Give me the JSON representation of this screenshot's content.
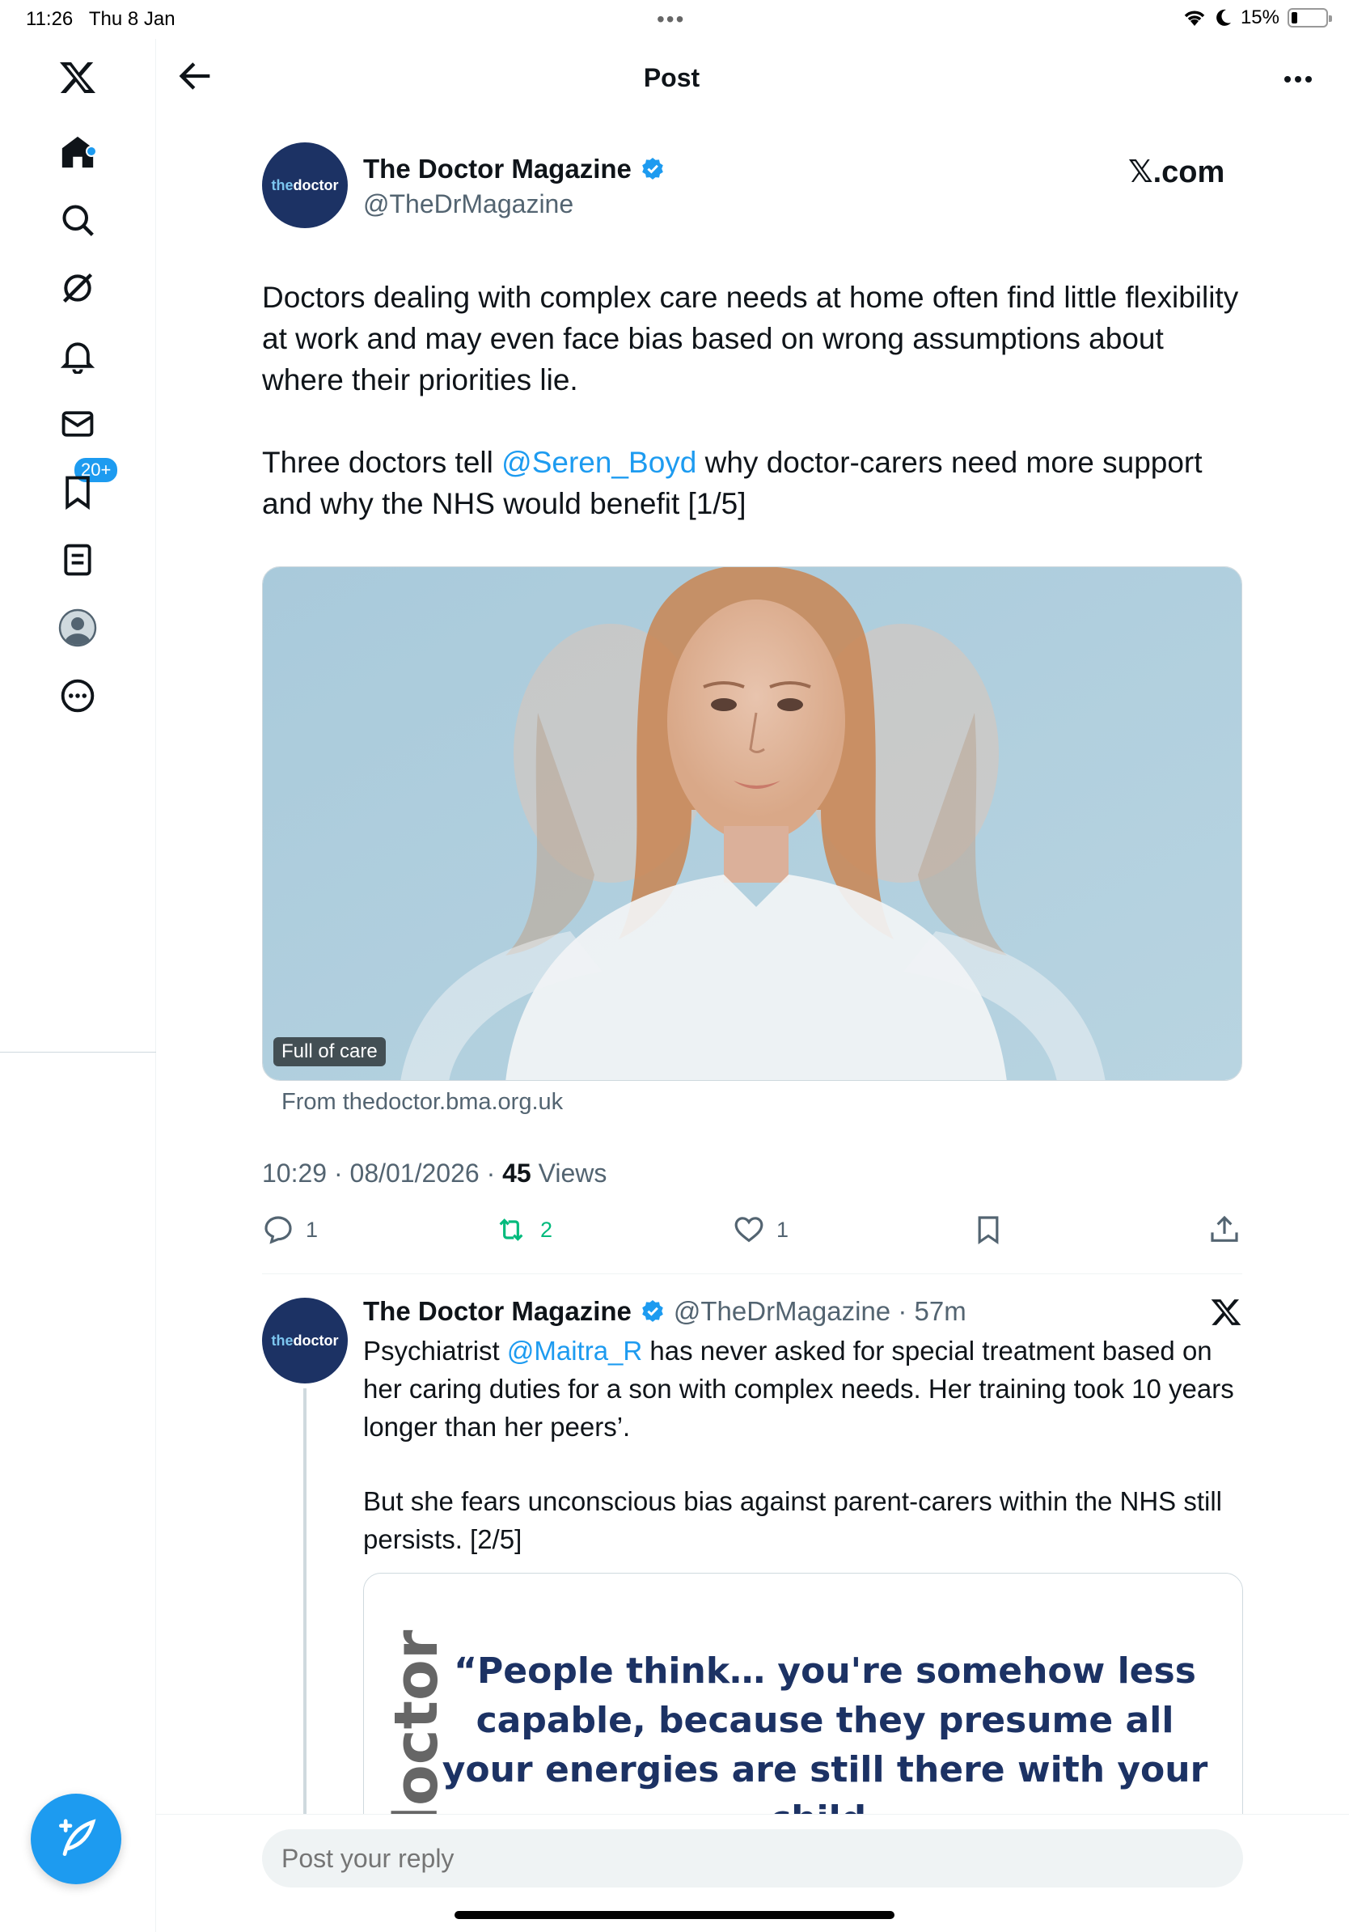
{
  "status_bar": {
    "time": "11:26",
    "date": "Thu 8 Jan",
    "battery": "15%",
    "battery_level": 0.15
  },
  "nav": {
    "items": [
      "x-logo",
      "home",
      "search",
      "grok",
      "notifications",
      "messages",
      "bookmarks",
      "lists",
      "profile",
      "more"
    ],
    "notifications_badge": "20+"
  },
  "header": {
    "title": "Post"
  },
  "post": {
    "author_name": "The Doctor Magazine",
    "author_handle": "@TheDrMagazine",
    "avatar_text_the": "the",
    "avatar_text_doctor": "doctor",
    "source_label": "𝕏.com",
    "paragraph1": "Doctors dealing with complex care needs at home often find little flexibility at work and may even face bias based on wrong assumptions about where their priorities lie.",
    "paragraph2_before": "Three doctors tell ",
    "paragraph2_mention": "@Seren_Boyd",
    "paragraph2_after": " why doctor-carers need more support and why the NHS would benefit [1/5]",
    "card_label": "Full of care",
    "card_from": "From thedoctor.bma.org.uk",
    "time": "10:29",
    "date": "08/01/2026",
    "views_count": "45",
    "views_label": "Views",
    "replies": "1",
    "reposts": "2",
    "likes": "1"
  },
  "reply": {
    "author_name": "The Doctor Magazine",
    "author_handle": "@TheDrMagazine",
    "time_ago": "57m",
    "text1_before": "Psychiatrist ",
    "text1_mention": "@Maitra_R",
    "text1_after": " has never asked for special treatment based on her caring duties for a son with complex needs. Her training took 10 years longer than her peers’.",
    "text2": "But she fears unconscious bias against parent-carers within the NHS still persists. [2/5]",
    "quote_side": "doctor",
    "quote_text": "“People think… you're somehow less capable, because they presume all your energies are still there with your child."
  },
  "composer": {
    "placeholder": "Post your reply"
  },
  "colors": {
    "accent": "#1d9bf0",
    "repost_green": "#00ba7c",
    "navy": "#1c3264"
  }
}
